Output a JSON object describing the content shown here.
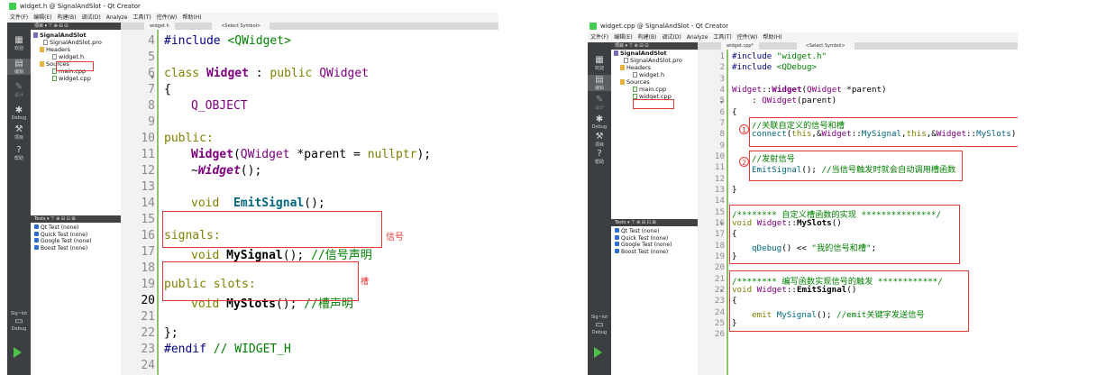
{
  "left": {
    "title": "widget.h @ SignalAndSlot - Qt Creator",
    "menu": [
      "文件(F)",
      "编辑(E)",
      "构建(B)",
      "调试(D)",
      "Analyze",
      "工具(T)",
      "控件(W)",
      "帮助(H)"
    ],
    "modes": [
      "欢迎",
      "编辑",
      "设计",
      "Debug",
      "项目",
      "帮助"
    ],
    "project_header": "项目",
    "tree": {
      "project": "SignalAndSlot",
      "pro_file": "SignalAndSlot.pro",
      "headers": "Headers",
      "header_file": "widget.h",
      "sources": "Sources",
      "main_cpp": "main.cpp",
      "widget_cpp": "widget.cpp"
    },
    "tests_header": "Tests",
    "tests": [
      "Qt Test (none)",
      "Quick Test (none)",
      "Google Test (none)",
      "Boost Test (none)"
    ],
    "bottom_target": "Sig~lot",
    "bottom_mode": "Debug",
    "editor_file": "widget.h",
    "editor_symbol": "<Select Symbol>",
    "line_numbers": [
      "4",
      "5",
      "6",
      "7",
      "8",
      "9",
      "10",
      "11",
      "12",
      "13",
      "14",
      "15",
      "16",
      "17",
      "18",
      "19",
      "20",
      "21",
      "22",
      "23",
      "24"
    ],
    "code": {
      "l4_pp": "#include",
      "l4_inc": "<QWidget>",
      "l6_class": "class",
      "l6_name": "Widget",
      "l6_colon": " : ",
      "l6_public": "public",
      "l6_base": "QWidget",
      "l7": "{",
      "l8": "Q_OBJECT",
      "l10": "public:",
      "l11_fn": "Widget",
      "l11_open": "(",
      "l11_type": "QWidget",
      "l11_rest": " *parent = ",
      "l11_null": "nullptr",
      "l11_end": ");",
      "l12_tilde": "~",
      "l12_fn": "Widget",
      "l12_end": "();",
      "l14_void": "void",
      "l14_fn": "EmitSignal",
      "l14_end": "();",
      "l16": "signals:",
      "l17_void": "void",
      "l17_fn": "MySignal",
      "l17_end": "(); ",
      "l17_cmt": "//信号声明",
      "l19": "public slots:",
      "l20_void": "void",
      "l20_fn": "MySlots",
      "l20_end": "(); ",
      "l20_cmt": "//槽声明",
      "l22": "};",
      "l23_pp": "#endif",
      "l23_cmt": " // WIDGET_H"
    },
    "annotations": {
      "signal": "信号",
      "slot": "槽"
    }
  },
  "right": {
    "title": "widget.cpp @ SignalAndSlot - Qt Creator",
    "menu": [
      "文件(F)",
      "编辑(E)",
      "构建(B)",
      "调试(D)",
      "Analyze",
      "工具(T)",
      "控件(W)",
      "帮助(H)"
    ],
    "modes": [
      "欢迎",
      "编辑",
      "设计",
      "Debug",
      "项目",
      "帮助"
    ],
    "project_header": "项目",
    "tree": {
      "project": "SignalAndSlot",
      "pro_file": "SignalAndSlot.pro",
      "headers": "Headers",
      "header_file": "widget.h",
      "sources": "Sources",
      "main_cpp": "main.cpp",
      "widget_cpp": "widget.cpp"
    },
    "tests_header": "Tests",
    "tests": [
      "Qt Test (none)",
      "Quick Test (none)",
      "Google Test (none)",
      "Boost Test (none)"
    ],
    "bottom_target": "Sig~lot",
    "bottom_mode": "Debug",
    "editor_file": "widget.cpp*",
    "editor_symbol": "<Select Symbol>",
    "line_numbers": [
      "1",
      "2",
      "3",
      "4",
      "5",
      "6",
      "7",
      "8",
      "9",
      "10",
      "11",
      "12",
      "13",
      "14",
      "15",
      "16",
      "17",
      "18",
      "19",
      "20",
      "21",
      "22",
      "23",
      "24",
      "25",
      "26"
    ],
    "code": {
      "l1_pp": "#include",
      "l1_inc": " \"widget.h\"",
      "l2_pp": "#include",
      "l2_inc": " <QDebug>",
      "l4_cls": "Widget",
      "l4_sep": "::",
      "l4_fn": "Widget",
      "l4_open": "(",
      "l4_type": "QWidget",
      "l4_rest": " *parent)",
      "l5_colon": "    : ",
      "l5_type": "QWidget",
      "l5_rest": "(parent)",
      "l6": "{",
      "l7_cmt": "//关联自定义的信号和槽",
      "l8_fn": "connect",
      "l8_a": "(",
      "l8_this1": "this",
      "l8_b": ",&",
      "l8_cls1": "Widget",
      "l8_c": "::",
      "l8_sig": "MySignal",
      "l8_d": ",",
      "l8_this2": "this",
      "l8_e": ",&",
      "l8_cls2": "Widget",
      "l8_f": "::",
      "l8_slot": "MySlots",
      "l8_g": ");",
      "l10_cmt": "//发射信号",
      "l11_fn": "EmitSignal",
      "l11_end": "(); ",
      "l11_cmt": "//当信号触发时就会自动调用槽函数",
      "l13": "}",
      "l15_cmt": "/******** 自定义槽函数的实现 ***************/",
      "l16_void": "void",
      "l16_cls": " Widget",
      "l16_sep": "::",
      "l16_fn": "MySlots",
      "l16_end": "()",
      "l17": "{",
      "l18_fn": "qDebug",
      "l18_mid": "() << ",
      "l18_str": "\"我的信号和槽\"",
      "l18_end": ";",
      "l19": "}",
      "l21_cmt": "/******** 编写函数实现信号的触发 ************/",
      "l22_void": "void",
      "l22_cls": " Widget",
      "l22_sep": "::",
      "l22_fn": "EmitSignal",
      "l22_end": "()",
      "l23": "{",
      "l24_emit": "emit",
      "l24_fn": " MySignal",
      "l24_end": "(); ",
      "l24_cmt": "//emit关键字发送信号",
      "l25": "}"
    },
    "markers": [
      "1",
      "2"
    ]
  }
}
